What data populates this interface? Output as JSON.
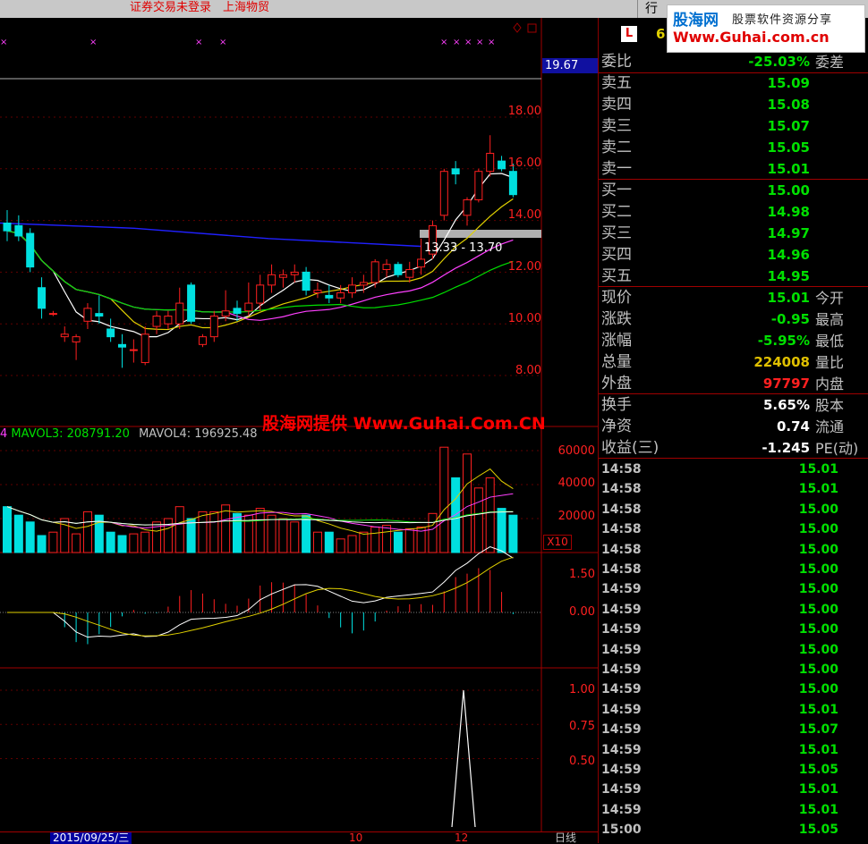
{
  "topbar": {
    "status": "证券交易未登录　上海物贸",
    "menu_label": "行"
  },
  "logo": {
    "name": "股海网",
    "tagline": "股票软件资源分享",
    "url": "Www.Guhai.com.cn"
  },
  "watermark": "股海网提供 Www.Guhai.Com.CN",
  "stock_code_badge": "L",
  "stock_code_partial": "6",
  "colors": {
    "up": "#ff2020",
    "down": "#00e0e0",
    "gain_text": "#ff2020",
    "loss_text": "#00e000",
    "volume_text": "#e0c000",
    "ma5": "#ffffff",
    "ma10": "#e0d000",
    "ma20": "#ff40ff",
    "ma30": "#00e000",
    "ma60": "#2020ff"
  },
  "price_axis": {
    "labels": [
      "19.67",
      "18.00",
      "16.00",
      "14.00",
      "12.00",
      "10.00",
      "8.00"
    ]
  },
  "range_label": "13.33 - 13.70",
  "volume": {
    "legend": [
      {
        "text": "4",
        "color": "#ff40ff"
      },
      {
        "text": "MAVOL3: 208791.20",
        "color": "#00e000"
      },
      {
        "text": "MAVOL4: 196925.48",
        "color": "#c0c0c0"
      }
    ],
    "axis_labels": [
      "60000",
      "40000",
      "20000"
    ],
    "unit": "X10"
  },
  "macd": {
    "axis_labels": [
      "1.50",
      "0.00"
    ]
  },
  "indicator": {
    "axis_labels": [
      "1.00",
      "0.75",
      "0.50"
    ]
  },
  "date_bar": {
    "date": "2015/09/25/三",
    "mark_1": "10",
    "mark_2": "12",
    "period": "日线"
  },
  "quote": {
    "weibi": {
      "label": "委比",
      "value": "-25.03%",
      "side": "委差"
    },
    "sell": [
      {
        "label": "卖五",
        "price": "15.09"
      },
      {
        "label": "卖四",
        "price": "15.08"
      },
      {
        "label": "卖三",
        "price": "15.07"
      },
      {
        "label": "卖二",
        "price": "15.05"
      },
      {
        "label": "卖一",
        "price": "15.01"
      }
    ],
    "buy": [
      {
        "label": "买一",
        "price": "15.00"
      },
      {
        "label": "买二",
        "price": "14.98"
      },
      {
        "label": "买三",
        "price": "14.97"
      },
      {
        "label": "买四",
        "price": "14.96"
      },
      {
        "label": "买五",
        "price": "14.95"
      }
    ],
    "stats": [
      {
        "label": "现价",
        "value": "15.01",
        "side": "今开",
        "color": "#00e000"
      },
      {
        "label": "涨跌",
        "value": "-0.95",
        "side": "最高",
        "color": "#00e000"
      },
      {
        "label": "涨幅",
        "value": "-5.95%",
        "side": "最低",
        "color": "#00e000"
      },
      {
        "label": "总量",
        "value": "224008",
        "side": "量比",
        "color": "#e0c000"
      },
      {
        "label": "外盘",
        "value": "97797",
        "side": "内盘",
        "color": "#ff2020"
      }
    ],
    "stats2": [
      {
        "label": "换手",
        "value": "5.65%",
        "side": "股本"
      },
      {
        "label": "净资",
        "value": "0.74",
        "side": "流通"
      },
      {
        "label": "收益(三)",
        "value": "-1.245",
        "side": "PE(动)"
      }
    ]
  },
  "ticks": [
    {
      "time": "14:58",
      "price": "15.01"
    },
    {
      "time": "14:58",
      "price": "15.01"
    },
    {
      "time": "14:58",
      "price": "15.00"
    },
    {
      "time": "14:58",
      "price": "15.00"
    },
    {
      "time": "14:58",
      "price": "15.00"
    },
    {
      "time": "14:58",
      "price": "15.00"
    },
    {
      "time": "14:59",
      "price": "15.00"
    },
    {
      "time": "14:59",
      "price": "15.00"
    },
    {
      "time": "14:59",
      "price": "15.00"
    },
    {
      "time": "14:59",
      "price": "15.00"
    },
    {
      "time": "14:59",
      "price": "15.00"
    },
    {
      "time": "14:59",
      "price": "15.00"
    },
    {
      "time": "14:59",
      "price": "15.01"
    },
    {
      "time": "14:59",
      "price": "15.07"
    },
    {
      "time": "14:59",
      "price": "15.01"
    },
    {
      "time": "14:59",
      "price": "15.05"
    },
    {
      "time": "14:59",
      "price": "15.01"
    },
    {
      "time": "14:59",
      "price": "15.01"
    },
    {
      "time": "15:00",
      "price": "15.05"
    }
  ],
  "candles": [
    {
      "o": 13.9,
      "h": 14.4,
      "l": 13.2,
      "c": 13.6
    },
    {
      "o": 13.8,
      "h": 14.2,
      "l": 13.2,
      "c": 13.4
    },
    {
      "o": 13.5,
      "h": 13.7,
      "l": 12.0,
      "c": 12.2
    },
    {
      "o": 11.4,
      "h": 11.8,
      "l": 10.2,
      "c": 10.6
    },
    {
      "o": 10.4,
      "h": 10.5,
      "l": 10.3,
      "c": 10.4
    },
    {
      "o": 9.5,
      "h": 9.9,
      "l": 9.3,
      "c": 9.6
    },
    {
      "o": 9.3,
      "h": 9.6,
      "l": 8.6,
      "c": 9.5
    },
    {
      "o": 10.1,
      "h": 10.8,
      "l": 9.8,
      "c": 10.6
    },
    {
      "o": 10.4,
      "h": 11.1,
      "l": 10.0,
      "c": 10.3
    },
    {
      "o": 9.8,
      "h": 10.2,
      "l": 9.3,
      "c": 9.5
    },
    {
      "o": 9.2,
      "h": 9.6,
      "l": 8.3,
      "c": 9.1
    },
    {
      "o": 9.0,
      "h": 9.4,
      "l": 8.5,
      "c": 9.0
    },
    {
      "o": 8.5,
      "h": 9.9,
      "l": 8.4,
      "c": 9.6
    },
    {
      "o": 9.9,
      "h": 10.5,
      "l": 9.6,
      "c": 10.3
    },
    {
      "o": 10.0,
      "h": 10.5,
      "l": 9.8,
      "c": 10.3
    },
    {
      "o": 10.0,
      "h": 11.4,
      "l": 9.8,
      "c": 10.8
    },
    {
      "o": 11.5,
      "h": 11.6,
      "l": 10.0,
      "c": 10.1
    },
    {
      "o": 9.2,
      "h": 9.6,
      "l": 9.1,
      "c": 9.5
    },
    {
      "o": 9.5,
      "h": 10.5,
      "l": 9.3,
      "c": 10.3
    },
    {
      "o": 10.3,
      "h": 11.3,
      "l": 10.1,
      "c": 10.5
    },
    {
      "o": 10.6,
      "h": 10.9,
      "l": 10.1,
      "c": 10.4
    },
    {
      "o": 10.5,
      "h": 11.6,
      "l": 10.3,
      "c": 10.8
    },
    {
      "o": 10.8,
      "h": 11.9,
      "l": 10.5,
      "c": 11.5
    },
    {
      "o": 11.5,
      "h": 12.3,
      "l": 11.2,
      "c": 11.9
    },
    {
      "o": 11.8,
      "h": 12.1,
      "l": 11.4,
      "c": 11.9
    },
    {
      "o": 11.9,
      "h": 12.3,
      "l": 11.6,
      "c": 12.0
    },
    {
      "o": 12.0,
      "h": 12.2,
      "l": 11.1,
      "c": 11.3
    },
    {
      "o": 11.2,
      "h": 11.6,
      "l": 11.0,
      "c": 11.3
    },
    {
      "o": 11.1,
      "h": 11.5,
      "l": 10.8,
      "c": 11.0
    },
    {
      "o": 11.0,
      "h": 11.5,
      "l": 10.8,
      "c": 11.2
    },
    {
      "o": 11.2,
      "h": 11.8,
      "l": 11.0,
      "c": 11.5
    },
    {
      "o": 11.5,
      "h": 11.9,
      "l": 11.2,
      "c": 11.6
    },
    {
      "o": 11.6,
      "h": 12.5,
      "l": 11.4,
      "c": 12.4
    },
    {
      "o": 12.1,
      "h": 12.5,
      "l": 11.8,
      "c": 12.3
    },
    {
      "o": 12.3,
      "h": 12.4,
      "l": 11.8,
      "c": 11.9
    },
    {
      "o": 11.8,
      "h": 12.4,
      "l": 11.6,
      "c": 12.1
    },
    {
      "o": 12.2,
      "h": 13.3,
      "l": 11.9,
      "c": 12.5
    },
    {
      "o": 12.7,
      "h": 14.0,
      "l": 12.5,
      "c": 13.8
    },
    {
      "o": 14.2,
      "h": 16.0,
      "l": 14.0,
      "c": 15.9
    },
    {
      "o": 16.0,
      "h": 16.3,
      "l": 15.4,
      "c": 15.8
    },
    {
      "o": 14.2,
      "h": 14.9,
      "l": 13.8,
      "c": 14.8
    },
    {
      "o": 14.8,
      "h": 16.0,
      "l": 14.7,
      "c": 15.9
    },
    {
      "o": 15.9,
      "h": 17.3,
      "l": 15.7,
      "c": 16.6
    },
    {
      "o": 16.3,
      "h": 16.5,
      "l": 15.9,
      "c": 16.0
    },
    {
      "o": 15.9,
      "h": 16.2,
      "l": 14.9,
      "c": 15.0
    }
  ],
  "volumes": [
    27000,
    22000,
    18000,
    10000,
    12000,
    20000,
    11000,
    24000,
    22000,
    12000,
    10000,
    11000,
    12000,
    18000,
    20000,
    27000,
    20000,
    24000,
    24000,
    28000,
    23000,
    22000,
    26000,
    22000,
    20000,
    18000,
    22000,
    12000,
    12000,
    8000,
    10000,
    12000,
    15000,
    16000,
    12000,
    14000,
    15000,
    23000,
    62000,
    44000,
    58000,
    38000,
    44000,
    26000,
    22000
  ]
}
